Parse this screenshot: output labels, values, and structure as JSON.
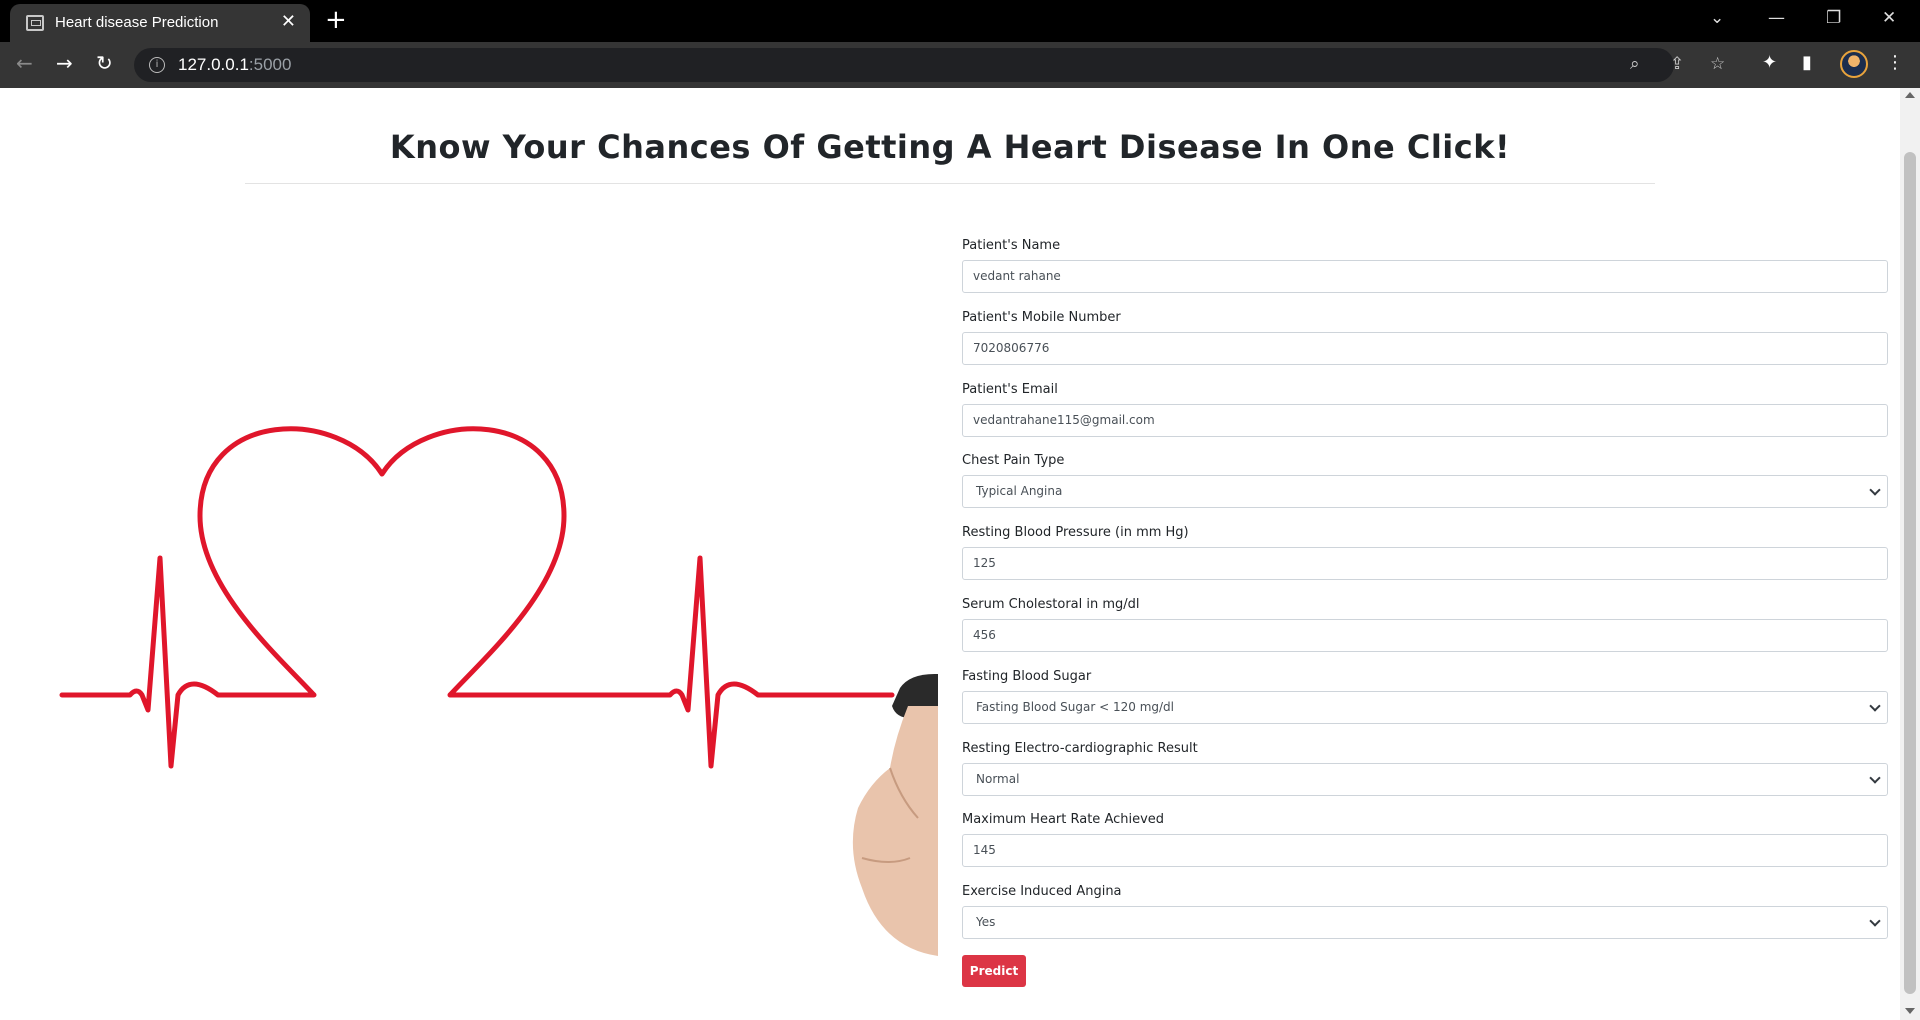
{
  "browser": {
    "tab_title": "Heart disease Prediction",
    "url_host": "127.0.0.1",
    "url_port": ":5000"
  },
  "page": {
    "title": "Know Your Chances Of Getting A Heart Disease In One Click!"
  },
  "form": {
    "fields": [
      {
        "label": "Patient's Name",
        "value": "vedant rahane",
        "type": "text"
      },
      {
        "label": "Patient's Mobile Number",
        "value": "7020806776",
        "type": "text"
      },
      {
        "label": "Patient's Email",
        "value": "vedantrahane115@gmail.com",
        "type": "text"
      },
      {
        "label": "Chest Pain Type",
        "value": "Typical Angina",
        "type": "select"
      },
      {
        "label": "Resting Blood Pressure (in mm Hg)",
        "value": "125",
        "type": "text"
      },
      {
        "label": "Serum Cholestoral in mg/dl",
        "value": "456",
        "type": "text"
      },
      {
        "label": "Fasting Blood Sugar",
        "value": "Fasting Blood Sugar < 120 mg/dl",
        "type": "select"
      },
      {
        "label": "Resting Electro-cardiographic Result",
        "value": "Normal",
        "type": "select"
      },
      {
        "label": "Maximum Heart Rate Achieved",
        "value": "145",
        "type": "text"
      },
      {
        "label": "Exercise Induced Angina",
        "value": "Yes",
        "type": "select"
      }
    ],
    "submit_label": "Predict"
  },
  "colors": {
    "accent_red": "#dc3545",
    "heartline_red": "#e0162b"
  }
}
